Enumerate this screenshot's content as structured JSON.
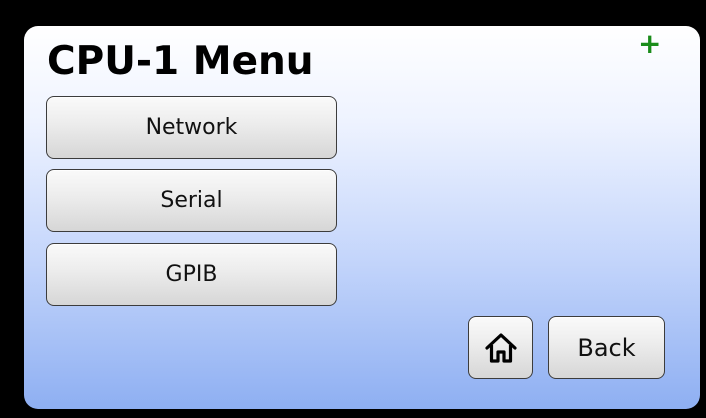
{
  "header": {
    "title": "CPU-1 Menu",
    "status_indicator": "+",
    "status_color": "#1a8c1a"
  },
  "menu": {
    "items": [
      {
        "label": "Network"
      },
      {
        "label": "Serial"
      },
      {
        "label": "GPIB"
      }
    ]
  },
  "footer": {
    "home_icon": "home-icon",
    "back_label": "Back"
  },
  "theme": {
    "background": "#000000",
    "screen_gradient_top": "#ffffff",
    "screen_gradient_bottom": "#8eaff2"
  }
}
